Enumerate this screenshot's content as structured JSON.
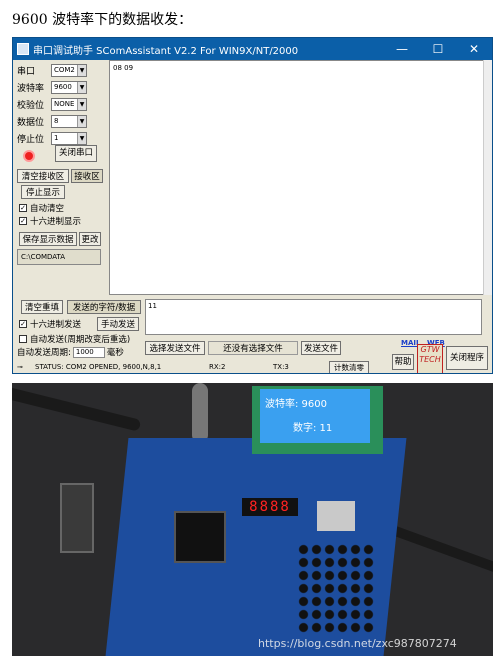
{
  "caption": "9600 波特率下的数据收发：",
  "window": {
    "title": "串口调试助手 SComAssistant V2.2 For WIN9X/NT/2000",
    "minimize": "—",
    "maximize": "☐",
    "close": "✕"
  },
  "settings": {
    "port_label": "串口",
    "port_value": "COM2",
    "baud_label": "波特率",
    "baud_value": "9600",
    "parity_label": "校验位",
    "parity_value": "NONE",
    "databits_label": "数据位",
    "databits_value": "8",
    "stopbits_label": "停止位",
    "stopbits_value": "1"
  },
  "buttons": {
    "close_port": "关闭串口",
    "clear_recv": "清空接收区",
    "recv_area": "接收区",
    "stop_display": "停止显示",
    "save_display": "保存显示数据",
    "change": "更改",
    "clear_resend": "清空重填",
    "send_char": "发送的字符/数据",
    "manual_send": "手动发送",
    "choose_file": "选择发送文件",
    "no_file": "还没有选择文件",
    "send_file": "发送文件",
    "count_clear": "计数清零",
    "help": "帮助",
    "close_app": "关闭程序"
  },
  "checks": {
    "auto_clear": "自动清空",
    "hex_display": "十六进制显示",
    "hex_send": "十六进制发送",
    "auto_send": "自动发送(周期改变后重选)"
  },
  "auto_send_period_label": "自动发送周期:",
  "auto_send_period_value": "1000",
  "period_unit": "毫秒",
  "save_path": "C:\\COMDATA",
  "receive_text": "08 09",
  "send_text": "11",
  "links": {
    "mail": "MAIL",
    "web": "WEB"
  },
  "logo_text": "GTW TECH",
  "status": {
    "main": "STATUS: COM2 OPENED, 9600,N,8,1",
    "rx": "RX:2",
    "tx": "TX:3"
  },
  "lcd": {
    "line1": "波特率: 9600",
    "line2": "数字: 11"
  },
  "seven_segment": "8888",
  "watermark": "https://blog.csdn.net/zxc987807274",
  "colors": {
    "titlebar": "#0b5fa8",
    "lcd_screen": "#3aa0f0",
    "pcb": "#1d4d9e"
  }
}
